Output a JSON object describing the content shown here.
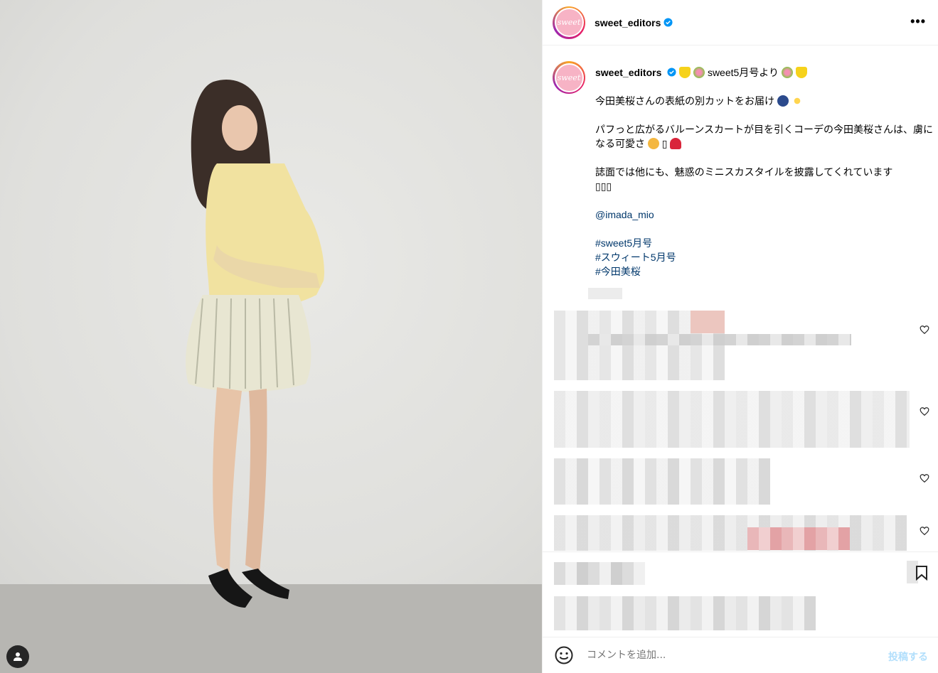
{
  "post": {
    "username": "sweet_editors",
    "avatar_text": "sweet",
    "more_label": "•••"
  },
  "caption": {
    "username": "sweet_editors",
    "line1": "sweet5月号より",
    "line2": "今田美桜さんの表紙の別カットをお届け",
    "line3": "パフっと広がるバルーンスカートが目を引くコーデの今田美桜さんは、虜になる可愛さ",
    "line4": "誌面では他にも、魅惑のミニスカスタイルを披露してくれています",
    "line4b": "▯▯▯",
    "mention": "@imada_mio",
    "hashtags": [
      "#sweet5月号",
      "#スウィート5月号",
      "#今田美桜"
    ]
  },
  "comment_box": {
    "placeholder": "コメントを追加...",
    "post_label": "投稿する"
  },
  "colors": {
    "link": "#00376b",
    "verified": "#0095f6",
    "post_btn_disabled": "#b2dffc"
  },
  "icons": [
    "verified-icon",
    "more-icon",
    "heart-icon",
    "smile-icon",
    "bookmark-icon",
    "user-tag-icon"
  ]
}
